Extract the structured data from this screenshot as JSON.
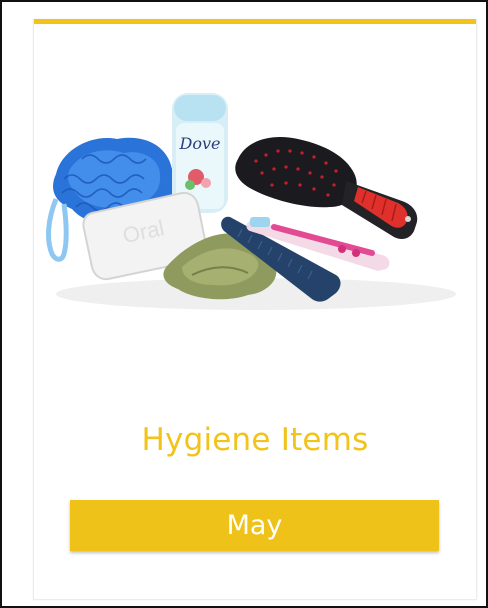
{
  "card": {
    "accent_color": "#f1c31b",
    "image": {
      "icon": "hygiene-products-photo",
      "soap_wrapper_text": "Oral",
      "deodorant_brand_text": "Dove"
    },
    "title": "Hygiene Items",
    "button_label": "May"
  }
}
